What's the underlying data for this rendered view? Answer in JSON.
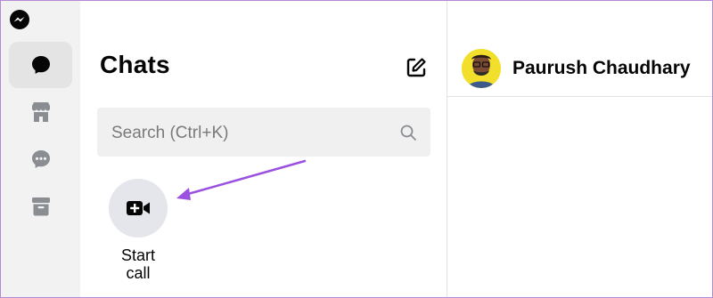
{
  "app": {
    "logo": "messenger-logo"
  },
  "rail": {
    "items": [
      {
        "name": "chats",
        "icon": "chat-bubble-icon",
        "active": true
      },
      {
        "name": "marketplace",
        "icon": "store-icon",
        "active": false
      },
      {
        "name": "requests",
        "icon": "message-requests-icon",
        "active": false
      },
      {
        "name": "archive",
        "icon": "archive-icon",
        "active": false
      }
    ]
  },
  "panel": {
    "title": "Chats",
    "compose_icon": "compose-icon",
    "search": {
      "placeholder": "Search (Ctrl+K)",
      "value": ""
    },
    "start_call": {
      "label_line1": "Start",
      "label_line2": "call",
      "icon": "video-plus-icon"
    },
    "annotation": {
      "color": "#9b51e0"
    }
  },
  "conversation": {
    "contact_name": "Paurush Chaudhary"
  },
  "colors": {
    "accent": "#9b51e0",
    "frame": "#b48ad6"
  }
}
